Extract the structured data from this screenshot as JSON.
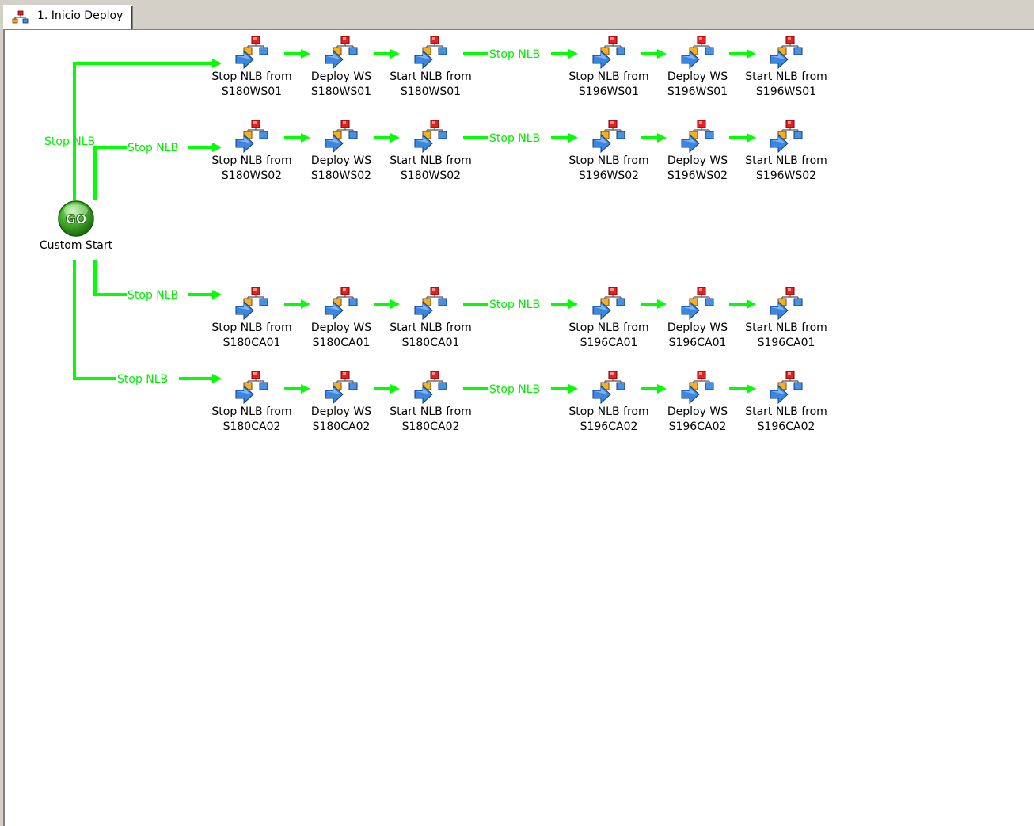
{
  "tab": {
    "label": "1. Inicio Deploy",
    "icon": "workflow-icon"
  },
  "colors": {
    "connector": "#00ff00",
    "canvas": "#ffffff",
    "chrome": "#d4d0c8"
  },
  "start": {
    "label": "Custom Start",
    "button_text": "GO",
    "icon": "go-button-icon"
  },
  "connector_label": "Stop NLB",
  "rows": [
    {
      "nodes": [
        {
          "line1": "Stop NLB from",
          "line2": "S180WS01"
        },
        {
          "line1": "Deploy WS",
          "line2": "S180WS01"
        },
        {
          "line1": "Start NLB from",
          "line2": "S180WS01"
        },
        {
          "line1": "Stop NLB from",
          "line2": "S196WS01"
        },
        {
          "line1": "Deploy WS",
          "line2": "S196WS01"
        },
        {
          "line1": "Start NLB from",
          "line2": "S196WS01"
        }
      ]
    },
    {
      "nodes": [
        {
          "line1": "Stop NLB from",
          "line2": "S180WS02"
        },
        {
          "line1": "Deploy WS",
          "line2": "S180WS02"
        },
        {
          "line1": "Start NLB from",
          "line2": "S180WS02"
        },
        {
          "line1": "Stop NLB from",
          "line2": "S196WS02"
        },
        {
          "line1": "Deploy WS",
          "line2": "S196WS02"
        },
        {
          "line1": "Start NLB from",
          "line2": "S196WS02"
        }
      ]
    },
    {
      "nodes": [
        {
          "line1": "Stop NLB from",
          "line2": "S180CA01"
        },
        {
          "line1": "Deploy WS",
          "line2": "S180CA01"
        },
        {
          "line1": "Start NLB from",
          "line2": "S180CA01"
        },
        {
          "line1": "Stop NLB from",
          "line2": "S196CA01"
        },
        {
          "line1": "Deploy WS",
          "line2": "S196CA01"
        },
        {
          "line1": "Start NLB from",
          "line2": "S196CA01"
        }
      ]
    },
    {
      "nodes": [
        {
          "line1": "Stop NLB from",
          "line2": "S180CA02"
        },
        {
          "line1": "Deploy WS",
          "line2": "S180CA02"
        },
        {
          "line1": "Start NLB from",
          "line2": "S180CA02"
        },
        {
          "line1": "Stop NLB from",
          "line2": "S196CA02"
        },
        {
          "line1": "Deploy WS",
          "line2": "S196CA02"
        },
        {
          "line1": "Start NLB from",
          "line2": "S196CA02"
        }
      ]
    }
  ]
}
